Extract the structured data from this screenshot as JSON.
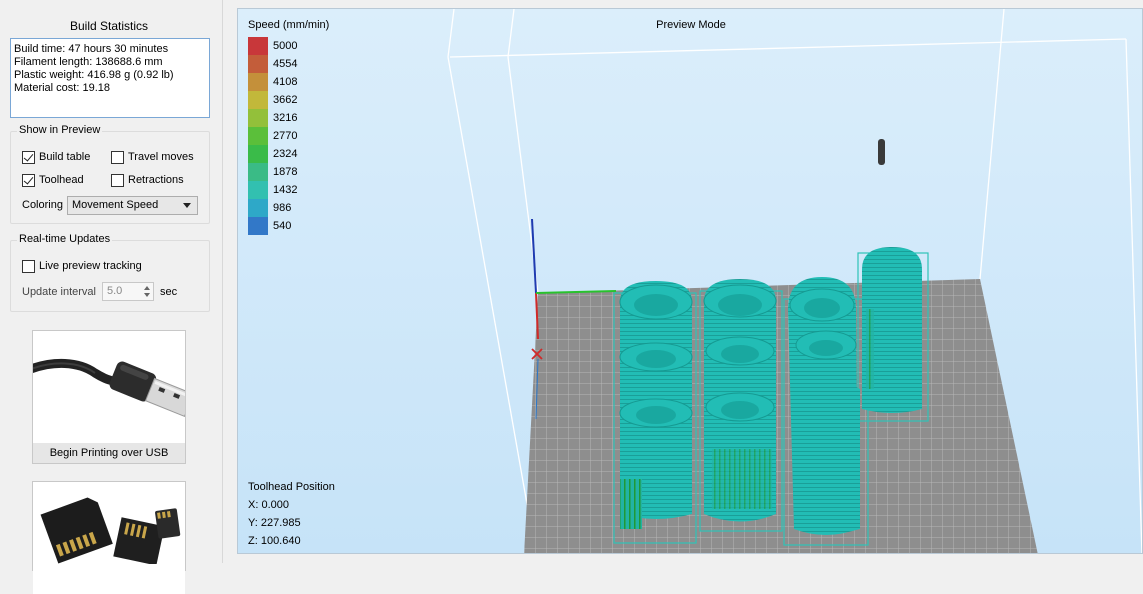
{
  "stats": {
    "title": "Build Statistics",
    "build_time": "Build time: 47 hours 30 minutes",
    "filament_length": "Filament length: 138688.6 mm",
    "plastic_weight": "Plastic weight: 416.98 g (0.92 lb)",
    "material_cost": "Material cost: 19.18"
  },
  "show_in_preview": {
    "title": "Show in Preview",
    "build_table": {
      "label": "Build table",
      "checked": true
    },
    "travel_moves": {
      "label": "Travel moves",
      "checked": false
    },
    "toolhead": {
      "label": "Toolhead",
      "checked": true
    },
    "retractions": {
      "label": "Retractions",
      "checked": false
    },
    "coloring_label": "Coloring",
    "coloring_value": "Movement Speed"
  },
  "realtime": {
    "title": "Real-time Updates",
    "live_preview": {
      "label": "Live preview tracking",
      "checked": false
    },
    "interval_label": "Update interval",
    "interval_value": "5.0",
    "interval_unit": "sec"
  },
  "actions": {
    "usb_label": "Begin Printing over USB"
  },
  "viewport": {
    "title": "Preview Mode",
    "legend_title": "Speed (mm/min)",
    "legend": [
      {
        "value": "5000",
        "color": "#c8373a"
      },
      {
        "value": "4554",
        "color": "#c35d3a"
      },
      {
        "value": "4108",
        "color": "#c4903a"
      },
      {
        "value": "3662",
        "color": "#c2b83a"
      },
      {
        "value": "3216",
        "color": "#93c03a"
      },
      {
        "value": "2770",
        "color": "#5bbf3a"
      },
      {
        "value": "2324",
        "color": "#3abb49"
      },
      {
        "value": "1878",
        "color": "#3abb86"
      },
      {
        "value": "1432",
        "color": "#32c0b0"
      },
      {
        "value": "986",
        "color": "#2ea8c8"
      },
      {
        "value": "540",
        "color": "#3278c8"
      }
    ],
    "toolhead_title": "Toolhead Position",
    "x": "X: 0.000",
    "y": "Y: 227.985",
    "z": "Z: 100.640"
  }
}
